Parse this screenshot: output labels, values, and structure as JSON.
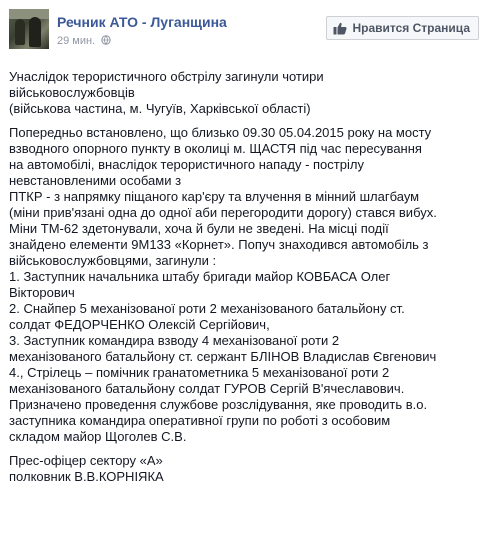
{
  "post": {
    "page_name": "Речник АТО - Луганщина",
    "time": "29 мин.",
    "like_button": "Нравится Страница",
    "paragraphs": [
      {
        "lines": [
          "Унаслідок терористичного обстрілу загинули чотири",
          "військовослужбовців",
          "(військова частина, м. Чугуїв, Харківської області)"
        ]
      },
      {
        "lines": [
          "Попередньо встановлено, що близько 09.30 05.04.2015 року на мосту",
          "взводного опорного пункту в околиці м. ЩАСТЯ під час пересування",
          "на автомобілі, внаслідок терористичного нападу - пострілу",
          "невстановленими особами з",
          "ПТКР - з напрямку піщаного кар'єру та влучення в мінний шлагбаум",
          "(міни прив'язані одна до одної аби перегородити дорогу) стався вибух.",
          "Міни ТМ-62 здетонували, хоча й були не зведені. На місці події",
          "знайдено елементи 9М133 «Корнет». Попуч знаходився автомобіль з",
          "військовослужбовцями, загинули :",
          "1. Заступник начальника штабу бригади майор КОВБАСА Олег",
          "Вікторович",
          "2. Снайпер 5 механізованої роти 2 механізованого батальйону ст.",
          "солдат ФЕДОРЧЕНКО Олексій Сергійович,",
          "3. Заступник командира взводу 4 механізованої роти 2",
          "механізованого батальйону ст. сержант БЛІНОВ Владислав Євгенович",
          "4., Стрілець – помічник гранатометника 5 механізованої роти 2",
          "механізованого батальйону солдат ГУРОВ Сергій В'ячеславович.",
          "Призначено проведення службове розслідування, яке проводить в.о.",
          "заступника командира оперативної групи по роботі з особовим",
          "складом майор Щоголев С.В."
        ]
      },
      {
        "lines": [
          "Прес-офіцер сектору «А»",
          "полковник В.В.КОРНІЯКА"
        ]
      }
    ]
  }
}
